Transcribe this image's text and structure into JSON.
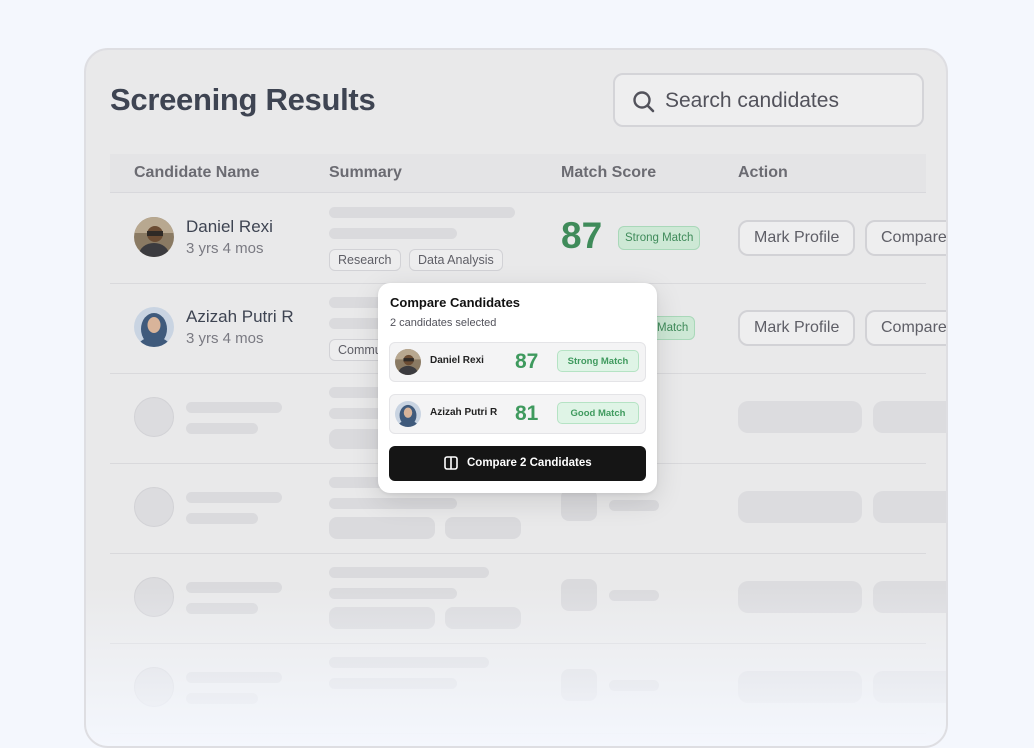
{
  "page": {
    "title": "Screening Results"
  },
  "search": {
    "placeholder": "Search candidates",
    "icon": "search-icon"
  },
  "table": {
    "headers": [
      "Candidate Name",
      "Summary",
      "Match Score",
      "Action"
    ],
    "rows": [
      {
        "name": "Daniel Rexi",
        "experience": "3 yrs 4 mos",
        "tags": [
          "Research",
          "Data Analysis"
        ],
        "score": "87",
        "match_label": "Strong Match",
        "mark_label": "Mark Profile",
        "compare_label": "Compare"
      },
      {
        "name": "Azizah Putri R",
        "experience": "3 yrs 4 mos",
        "tags": [
          "Commu"
        ],
        "match_label": "Match",
        "mark_label": "Mark Profile",
        "compare_label": "Compare"
      }
    ]
  },
  "compare_popup": {
    "title": "Compare Candidates",
    "subtitle": "2 candidates selected",
    "candidates": [
      {
        "name": "Daniel Rexi",
        "score": "87",
        "match_label": "Strong Match"
      },
      {
        "name": "Azizah Putri R",
        "score": "81",
        "match_label": "Good Match"
      }
    ],
    "button_label": "Compare 2 Candidates",
    "button_icon": "columns-icon"
  },
  "colors": {
    "accent_green": "#3f9a5e",
    "button_dark": "#151515",
    "background": "#f4f7fd"
  }
}
